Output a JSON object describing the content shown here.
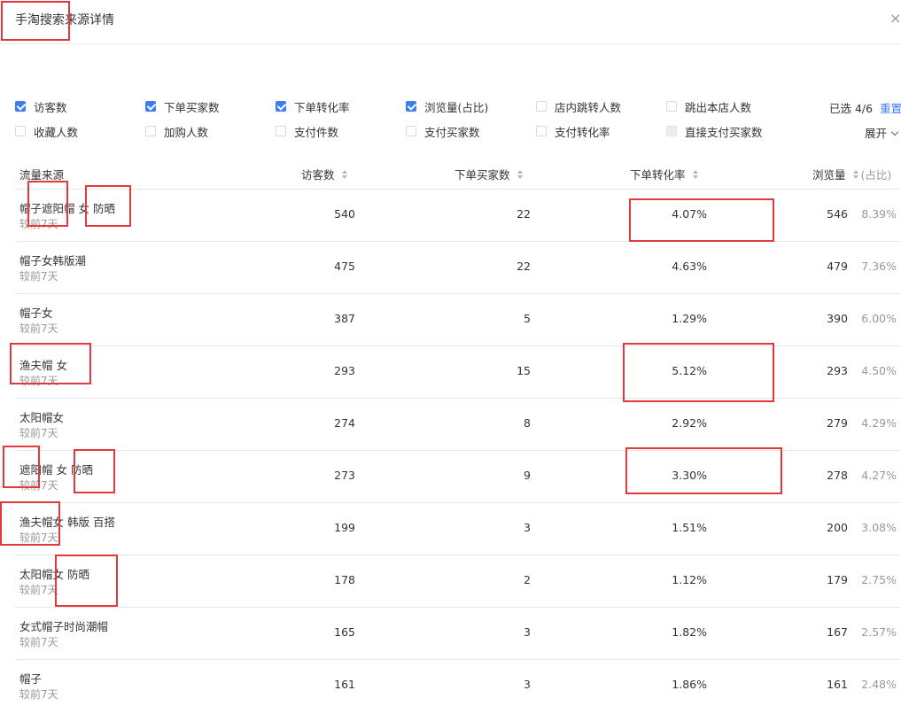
{
  "dialog": {
    "title": "手淘搜索来源详情",
    "close_label": "×"
  },
  "metrics": {
    "row1": [
      {
        "label": "访客数",
        "checked": true
      },
      {
        "label": "下单买家数",
        "checked": true
      },
      {
        "label": "下单转化率",
        "checked": true
      },
      {
        "label": "浏览量(占比)",
        "checked": true
      },
      {
        "label": "店内跳转人数",
        "checked": false
      },
      {
        "label": "跳出本店人数",
        "checked": false
      }
    ],
    "row2": [
      {
        "label": "收藏人数",
        "checked": false
      },
      {
        "label": "加购人数",
        "checked": false
      },
      {
        "label": "支付件数",
        "checked": false
      },
      {
        "label": "支付买家数",
        "checked": false
      },
      {
        "label": "支付转化率",
        "checked": false
      },
      {
        "label": "直接支付买家数",
        "checked": false,
        "disabled": true
      }
    ],
    "selected_text": "已选 4/6",
    "reset_label": "重置",
    "expand_label": "展开"
  },
  "table": {
    "headers": {
      "source": "流量来源",
      "visitors": "访客数",
      "buyers": "下单买家数",
      "conversion": "下单转化率",
      "pageviews": "浏览量",
      "share": "(占比)"
    },
    "compare_label": "较前7天",
    "rows": [
      {
        "source": "帽子遮阳帽 女 防晒",
        "visitors": "540",
        "buyers": "22",
        "conversion": "4.07%",
        "pageviews": "546",
        "share": "8.39%"
      },
      {
        "source": "帽子女韩版潮",
        "visitors": "475",
        "buyers": "22",
        "conversion": "4.63%",
        "pageviews": "479",
        "share": "7.36%"
      },
      {
        "source": "帽子女",
        "visitors": "387",
        "buyers": "5",
        "conversion": "1.29%",
        "pageviews": "390",
        "share": "6.00%"
      },
      {
        "source": "渔夫帽 女",
        "visitors": "293",
        "buyers": "15",
        "conversion": "5.12%",
        "pageviews": "293",
        "share": "4.50%"
      },
      {
        "source": "太阳帽女",
        "visitors": "274",
        "buyers": "8",
        "conversion": "2.92%",
        "pageviews": "279",
        "share": "4.29%"
      },
      {
        "source": "遮阳帽 女 防晒",
        "visitors": "273",
        "buyers": "9",
        "conversion": "3.30%",
        "pageviews": "278",
        "share": "4.27%"
      },
      {
        "source": "渔夫帽女 韩版 百搭",
        "visitors": "199",
        "buyers": "3",
        "conversion": "1.51%",
        "pageviews": "200",
        "share": "3.08%"
      },
      {
        "source": "太阳帽女 防晒",
        "visitors": "178",
        "buyers": "2",
        "conversion": "1.12%",
        "pageviews": "179",
        "share": "2.75%"
      },
      {
        "source": "女式帽子时尚潮帽",
        "visitors": "165",
        "buyers": "3",
        "conversion": "1.82%",
        "pageviews": "167",
        "share": "2.57%"
      },
      {
        "source": "帽子",
        "visitors": "161",
        "buyers": "3",
        "conversion": "1.86%",
        "pageviews": "161",
        "share": "2.48%"
      }
    ]
  },
  "colors": {
    "accent": "#3d7df4",
    "annotation": "#e4393c"
  }
}
